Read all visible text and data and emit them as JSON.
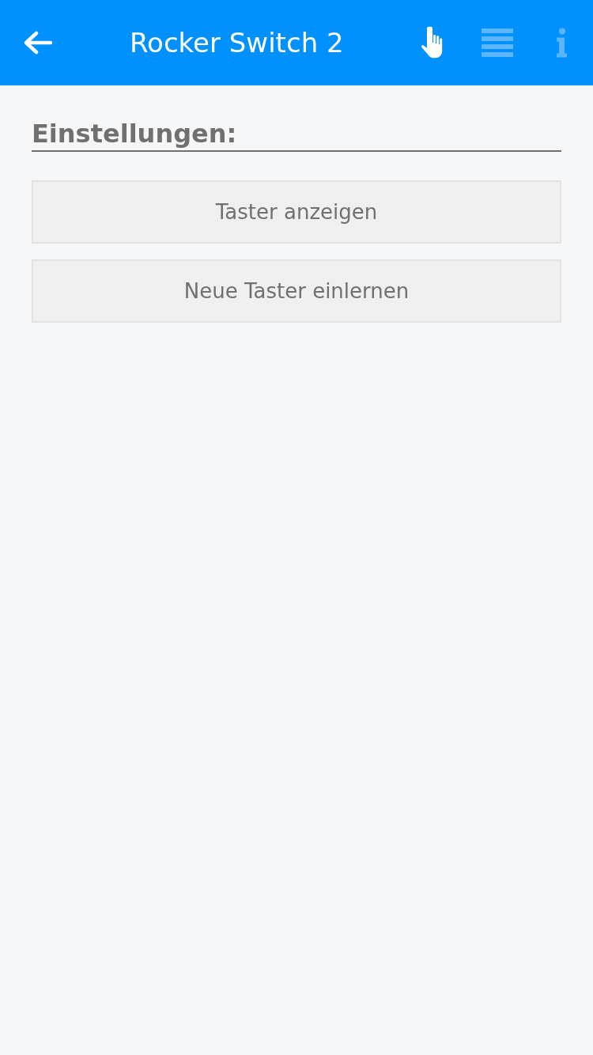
{
  "header": {
    "title": "Rocker Switch 2",
    "tabs": [
      {
        "kind": "hand",
        "selected": true
      },
      {
        "kind": "list",
        "selected": false
      },
      {
        "kind": "info",
        "selected": false
      }
    ]
  },
  "section": {
    "heading": "Einstellungen:"
  },
  "buttons": [
    "Taster anzeigen",
    "Neue Taster einlernen"
  ]
}
